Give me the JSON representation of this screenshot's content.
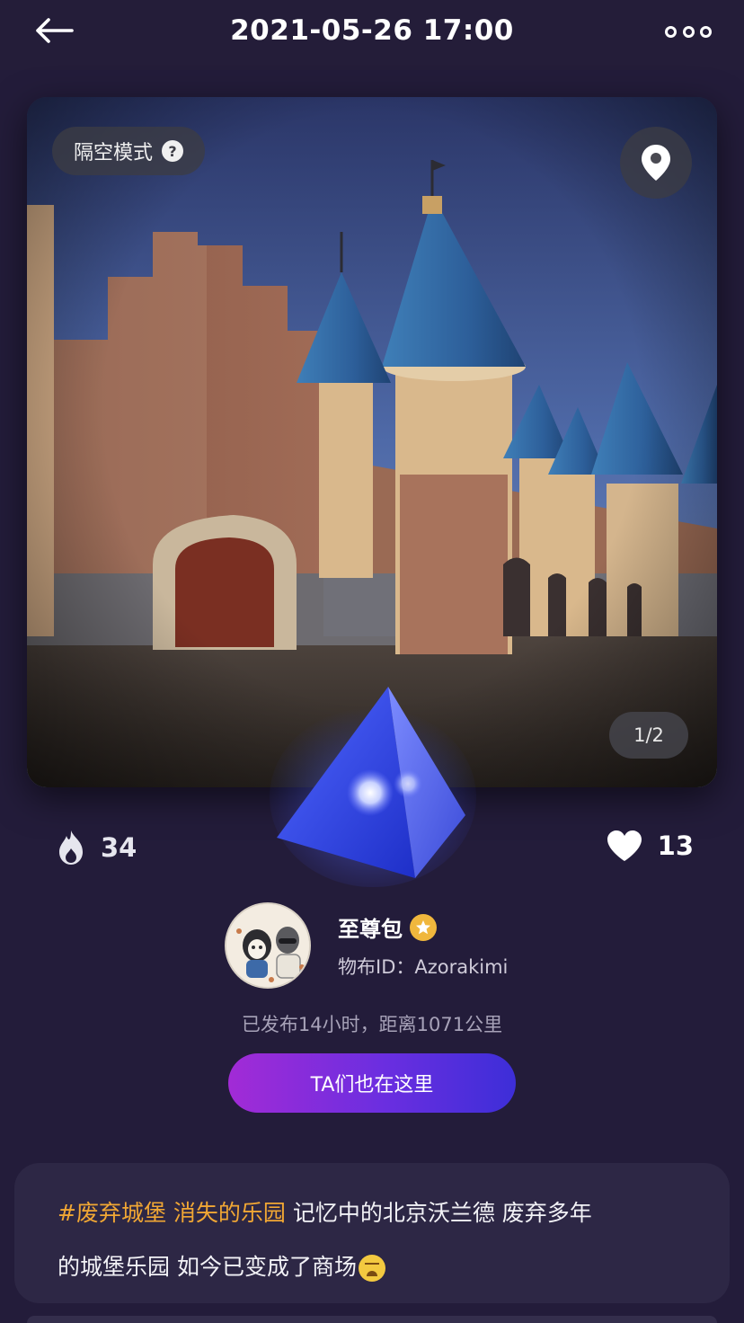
{
  "header": {
    "title": "2021-05-26 17:00"
  },
  "photo": {
    "mode_label": "隔空模式",
    "help_glyph": "?",
    "page_indicator": "1/2"
  },
  "stats": {
    "heat_count": "34",
    "like_count": "13"
  },
  "author": {
    "name": "至尊包",
    "id_line": "物布ID：Azorakimi"
  },
  "post_meta": "已发布14小时，距离1071公里",
  "cta_label": "TA们也在这里",
  "post": {
    "tag": "#废弃城堡 消失的乐园",
    "text_line1": " 记忆中的北京沃兰德 废弃多年",
    "text_line2": "的城堡乐园 如今已变成了商场"
  },
  "colors": {
    "background": "#231c3a",
    "tag": "#f1a734",
    "cta_start": "#a22bd6",
    "cta_end": "#3d2ed8",
    "badge": "#f0b73d"
  },
  "icons": [
    "back-arrow-icon",
    "more-dots-icon",
    "help-icon",
    "location-pin-icon",
    "flame-icon",
    "heart-icon",
    "verified-badge-icon",
    "emoji-tired-icon"
  ]
}
